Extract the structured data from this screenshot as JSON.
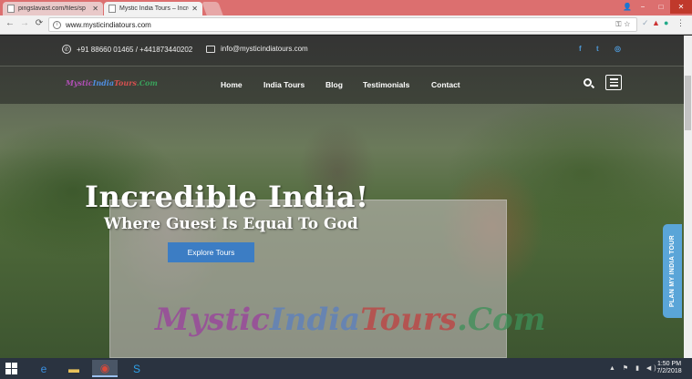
{
  "browser": {
    "tabs": [
      {
        "title": "pingslavast.com/files/sp",
        "active": false
      },
      {
        "title": "Mystic India Tours – Incre",
        "active": true
      }
    ],
    "url": "www.mysticindiatours.com",
    "window_controls": {
      "minimize": "−",
      "maximize": "□",
      "close": "✕"
    }
  },
  "topbar": {
    "phone": "+91 88660 01465 / +441873440202",
    "email": "info@mysticindiatours.com",
    "social": [
      "facebook",
      "twitter",
      "instagram"
    ]
  },
  "nav": {
    "logo": {
      "part1": "Mystic",
      "part2": "India",
      "part3": "Tours",
      "part4": ".Com"
    },
    "links": [
      "Home",
      "India Tours",
      "Blog",
      "Testimonials",
      "Contact"
    ]
  },
  "hero": {
    "headline": "Incredible India!",
    "subhead": "Where Guest Is Equal To God",
    "cta": "Explore Tours",
    "banner": {
      "part1": "Mystic",
      "part2": "India",
      "part3": "Tours",
      "part4": ".Com"
    },
    "side_tab": "PLAN MY INDIA TOUR"
  },
  "taskbar": {
    "time": "1:50 PM",
    "date": "7/2/2018",
    "apps": [
      "internet-explorer",
      "file-explorer",
      "chrome",
      "skype"
    ]
  },
  "colors": {
    "tab_bar": "#dc6f6f",
    "cta": "#3c7dc4",
    "side_tab": "#5aa5d8",
    "social": "#4e9ad8"
  }
}
